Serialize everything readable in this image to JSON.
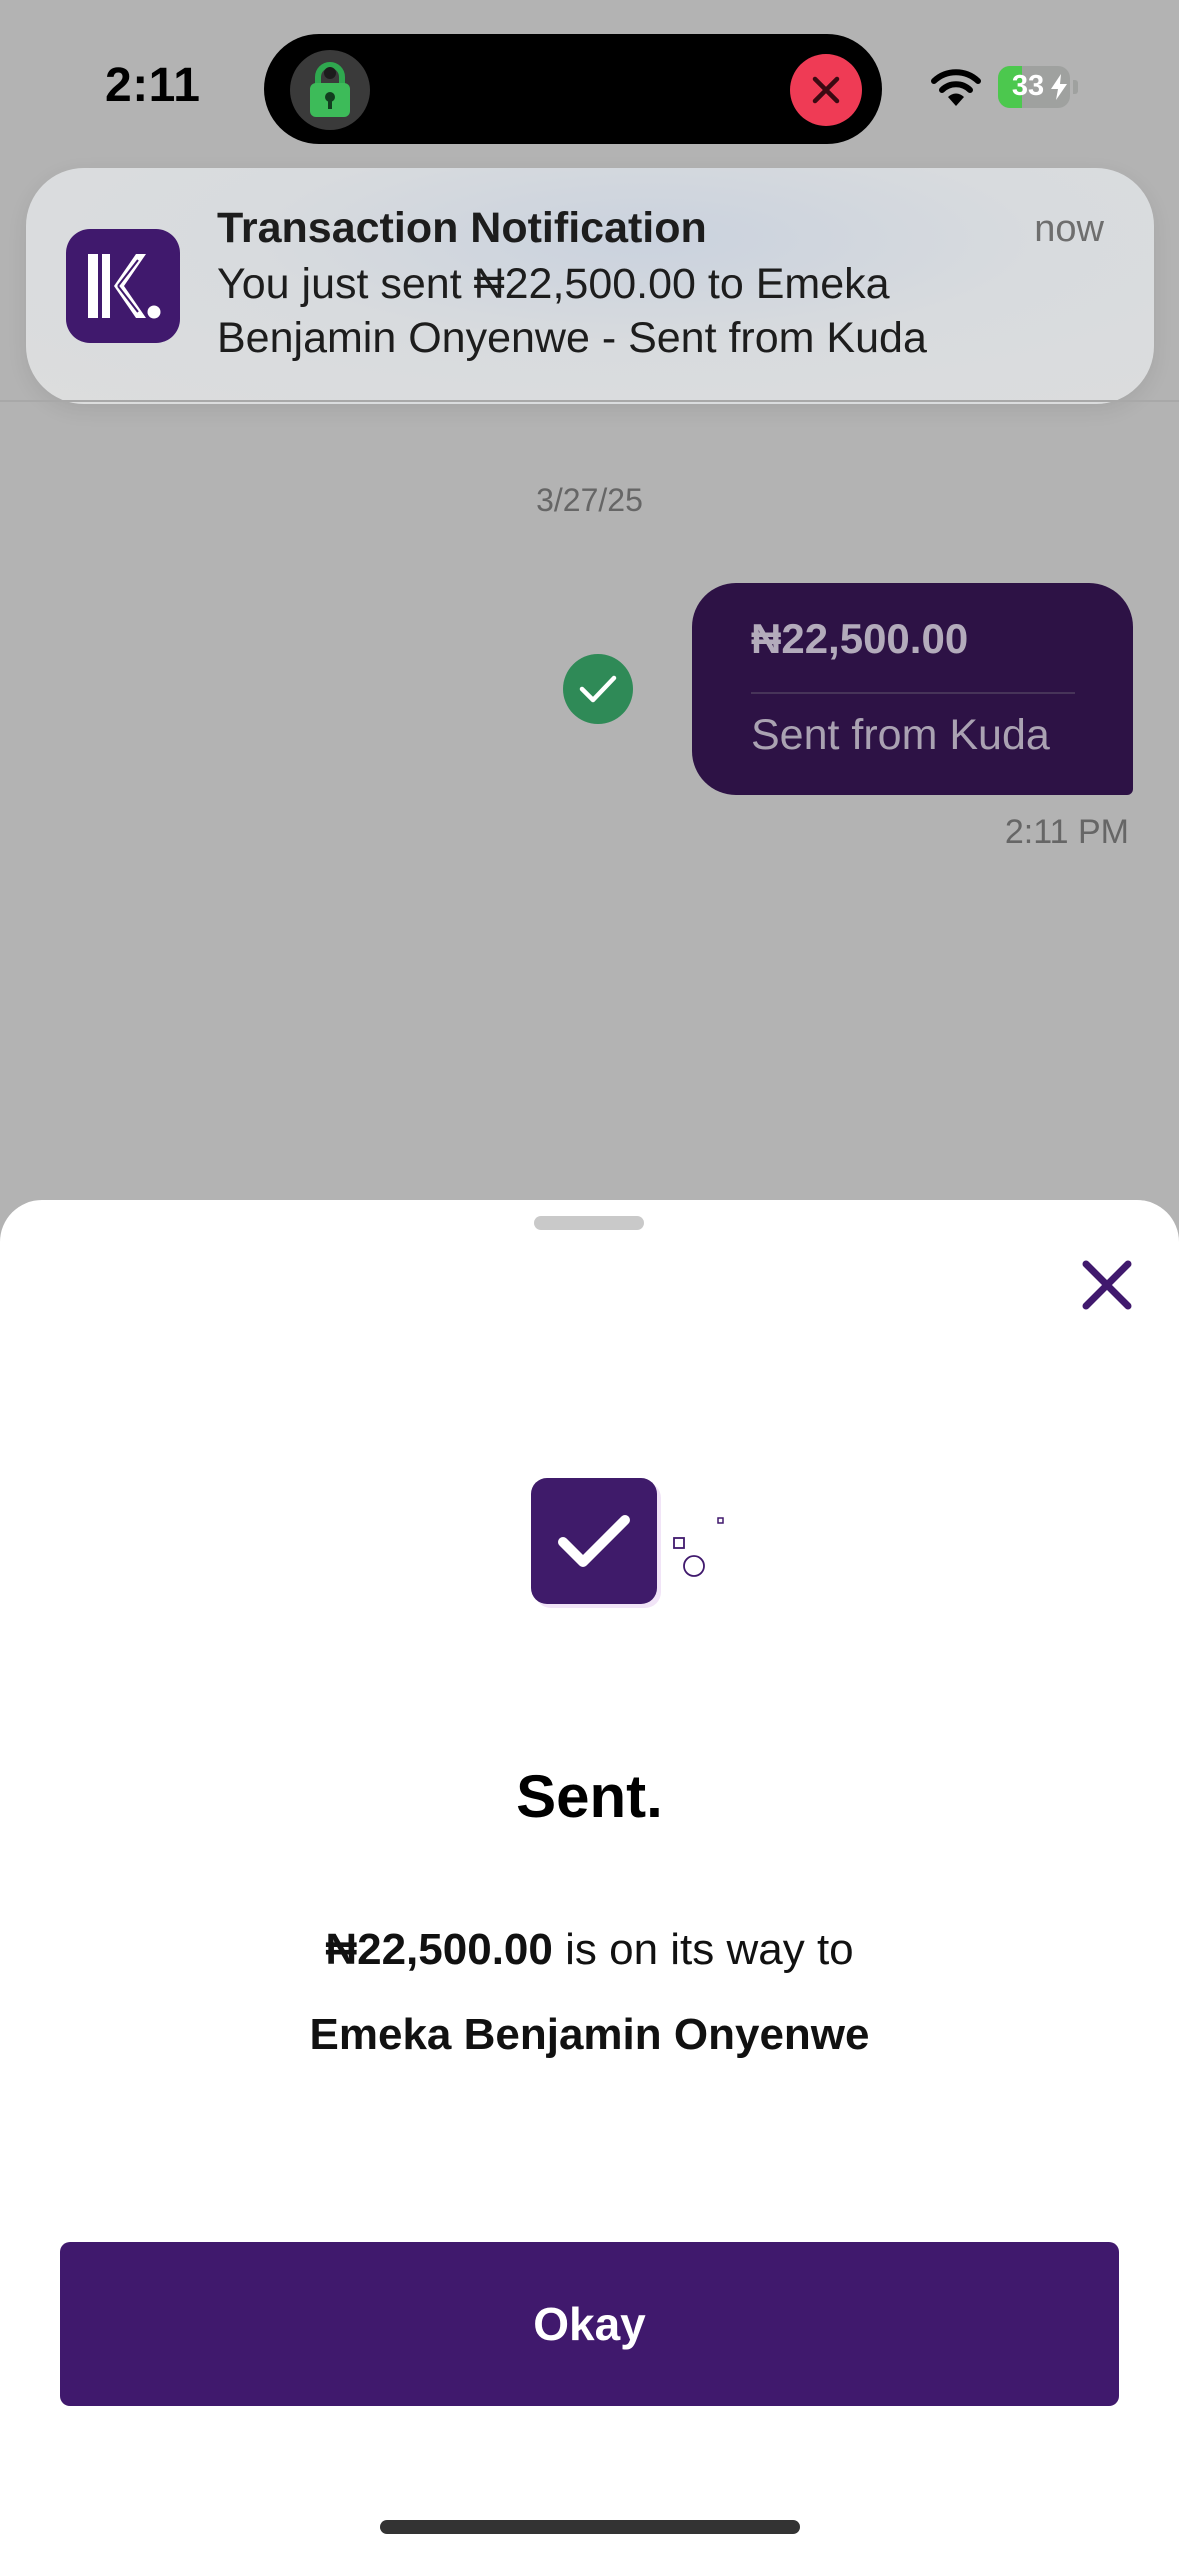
{
  "status_bar": {
    "time": "2:11",
    "battery_level": "33",
    "battery_fraction": 0.33,
    "icons": [
      "lock-vpn-icon",
      "close-icon",
      "wifi-icon",
      "battery-charging-icon"
    ]
  },
  "notification": {
    "app_icon": "kuda-logo-icon",
    "title": "Transaction Notification",
    "time": "now",
    "body": "You just sent ₦22,500.00 to Emeka Benjamin Onyenwe - Sent from Kuda"
  },
  "chat": {
    "date": "3/27/25",
    "message": {
      "amount": "₦22,500.00",
      "note": "Sent from Kuda",
      "time": "2:11 PM"
    }
  },
  "sheet": {
    "heading": "Sent.",
    "amount": "₦22,500.00",
    "line_suffix": " is on its way to",
    "recipient": "Emeka Benjamin Onyenwe",
    "button_label": "Okay"
  },
  "colors": {
    "brand_purple": "#40196d",
    "bubble_purple": "#2d1245",
    "success_green": "#2f8a57",
    "alert_red": "#ef3b55"
  }
}
